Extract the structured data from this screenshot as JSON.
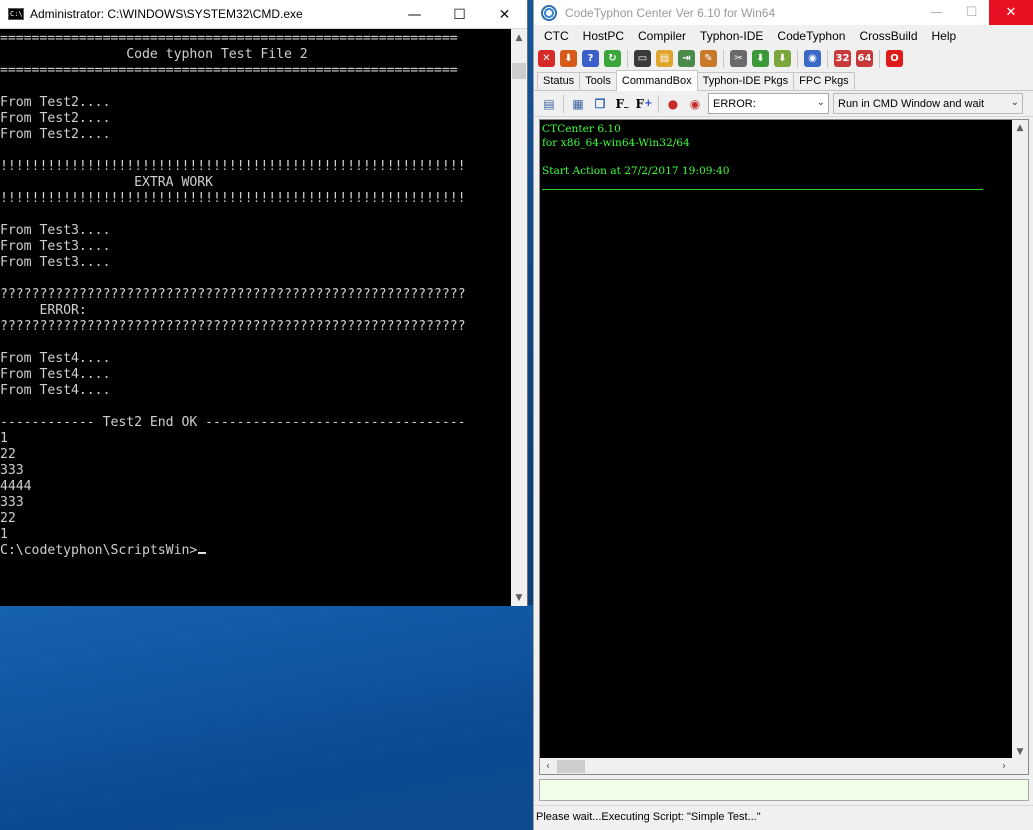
{
  "cmd": {
    "title": "Administrator: C:\\WINDOWS\\SYSTEM32\\CMD.exe",
    "icon_label": "C:\\",
    "lines": [
      "==========================================================",
      "                Code typhon Test File 2",
      "==========================================================",
      "",
      "From Test2....",
      "From Test2....",
      "From Test2....",
      "",
      "!!!!!!!!!!!!!!!!!!!!!!!!!!!!!!!!!!!!!!!!!!!!!!!!!!!!!!!!!!!",
      "                 EXTRA WORK",
      "!!!!!!!!!!!!!!!!!!!!!!!!!!!!!!!!!!!!!!!!!!!!!!!!!!!!!!!!!!!",
      "",
      "From Test3....",
      "From Test3....",
      "From Test3....",
      "",
      "???????????????????????????????????????????????????????????",
      "     ERROR:",
      "???????????????????????????????????????????????????????????",
      "",
      "From Test4....",
      "From Test4....",
      "From Test4....",
      "",
      "------------ Test2 End OK ---------------------------------",
      "1",
      "22",
      "333",
      "4444",
      "333",
      "22",
      "1"
    ],
    "prompt": "C:\\codetyphon\\ScriptsWin>"
  },
  "codetyphon": {
    "title": "CodeTyphon Center Ver 6.10 for Win64",
    "menu": [
      "CTC",
      "HostPC",
      "Compiler",
      "Typhon-IDE",
      "CodeTyphon",
      "CrossBuild",
      "Help"
    ],
    "toolbar_icons": [
      {
        "name": "stop-icon",
        "color": "#d92a2a",
        "glyph": "✕"
      },
      {
        "name": "download-icon",
        "color": "#d85a1a",
        "glyph": "⬇"
      },
      {
        "name": "help-icon",
        "color": "#3a5fc8",
        "glyph": "?"
      },
      {
        "name": "refresh-icon",
        "color": "#3aa63a",
        "glyph": "↻"
      },
      {
        "name": "terminal-icon",
        "color": "#3a3a3a",
        "glyph": "▭"
      },
      {
        "name": "folder-icon",
        "color": "#e0a52a",
        "glyph": "▤"
      },
      {
        "name": "exit-icon",
        "color": "#4a8a4a",
        "glyph": "⇥"
      },
      {
        "name": "clean-icon",
        "color": "#c87a2a",
        "glyph": "✎"
      },
      {
        "name": "tools-icon",
        "color": "#6a6a6a",
        "glyph": "✂"
      },
      {
        "name": "install-icon",
        "color": "#3a9a3a",
        "glyph": "⬇"
      },
      {
        "name": "package-icon",
        "color": "#7aa63a",
        "glyph": "⬇"
      },
      {
        "name": "network-icon",
        "color": "#3a6ac8",
        "glyph": "◉"
      },
      {
        "name": "build-32-icon",
        "color": "#c83a3a",
        "glyph": "32"
      },
      {
        "name": "build-64-icon",
        "color": "#c83a3a",
        "glyph": "64"
      },
      {
        "name": "opera-icon",
        "color": "#e01a1a",
        "glyph": "O"
      }
    ],
    "tabs": [
      "Status",
      "Tools",
      "CommandBox",
      "Typhon-IDE Pkgs",
      "FPC Pkgs"
    ],
    "active_tab": "CommandBox",
    "toolbar2": {
      "font_minus": "F",
      "font_plus": "F",
      "filter_value": "ERROR:",
      "run_mode": "Run in CMD Window and wait"
    },
    "console_lines": [
      "CTCenter 6.10",
      "for x86_64-win64-Win32/64",
      "",
      "Start Action at 27/2/2017 19:09:40"
    ],
    "status": "Please wait...Executing Script: \"Simple Test...\""
  }
}
